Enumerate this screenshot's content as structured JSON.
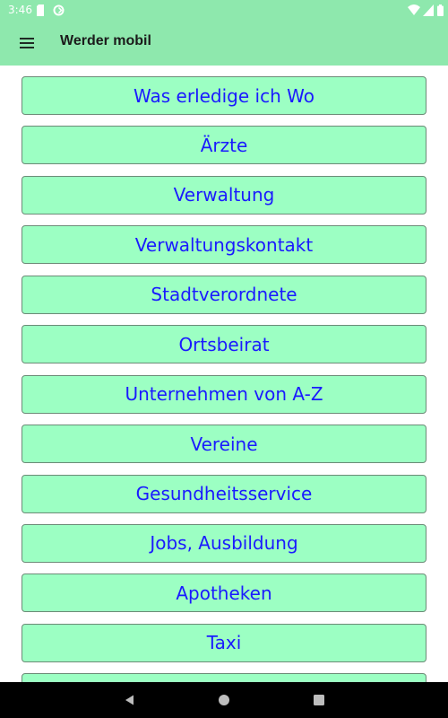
{
  "status_bar": {
    "time": "3:46",
    "icons": [
      "sd-card-icon",
      "sync-icon",
      "wifi-icon",
      "signal-icon",
      "battery-icon"
    ]
  },
  "app_bar": {
    "title": "Werder mobil",
    "menu_icon": "hamburger-menu-icon",
    "background_color": "#8ee8ad"
  },
  "menu": {
    "items": [
      {
        "label": "Was erledige ich Wo"
      },
      {
        "label": "Ärzte"
      },
      {
        "label": "Verwaltung"
      },
      {
        "label": "Verwaltungskontakt"
      },
      {
        "label": "Stadtverordnete"
      },
      {
        "label": "Ortsbeirat"
      },
      {
        "label": "Unternehmen von A-Z"
      },
      {
        "label": "Vereine"
      },
      {
        "label": "Gesundheitsservice"
      },
      {
        "label": "Jobs, Ausbildung"
      },
      {
        "label": "Apotheken"
      },
      {
        "label": "Taxi"
      },
      {
        "label": ""
      }
    ],
    "button_color": "#9cffc3",
    "text_color": "#1a1aff"
  },
  "nav_bar": {
    "icons": [
      "back-icon",
      "home-icon",
      "recents-icon"
    ]
  }
}
